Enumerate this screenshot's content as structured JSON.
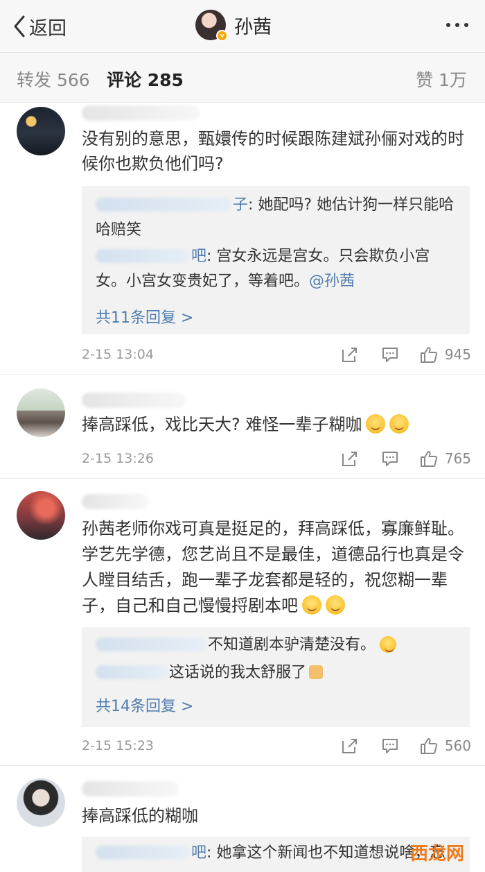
{
  "header": {
    "back_label": "返回",
    "profile_name": "孙茜",
    "verified_badge": "v"
  },
  "tabs": {
    "forward": "转发 566",
    "comment": "评论 285",
    "like": "赞 1万"
  },
  "comments": [
    {
      "text": "没有别的意思，甄嬛传的时候跟陈建斌孙俪对戏的时候你也欺负他们吗?",
      "replies": [
        {
          "name_tail": "子",
          "text": ": 她配吗? 她估计狗一样只能哈哈赔笑"
        },
        {
          "name_tail": "吧",
          "text": ": 宫女永远是宫女。只会欺负小宫女。小宫女变贵妃了，等着吧。",
          "mention": "@孙茜"
        }
      ],
      "more_replies": "共11条回复 >",
      "time": "2-15 13:04",
      "likes": "945"
    },
    {
      "text": "捧高踩低，戏比天大? 难怪一辈子糊咖",
      "time": "2-15 13:26",
      "likes": "765"
    },
    {
      "text": "孙茜老师你戏可真是挺足的，拜高踩低，寡廉鲜耻。学艺先学德，您艺尚且不是最佳，道德品行也真是令人瞠目结舌，跑一辈子龙套都是轻的，祝您糊一辈子，自己和自己慢慢捋剧本吧",
      "replies": [
        {
          "text": "不知道剧本驴清楚没有。"
        },
        {
          "text": "这话说的我太舒服了"
        }
      ],
      "more_replies": "共14条回复 >",
      "time": "2-15 15:23",
      "likes": "560"
    },
    {
      "text": "捧高踩低的糊咖",
      "replies": [
        {
          "name_tail": "吧",
          "text": ": 她拿这个新闻也不知道想说啥，忘"
        }
      ]
    }
  ],
  "watermark": "西龙网"
}
